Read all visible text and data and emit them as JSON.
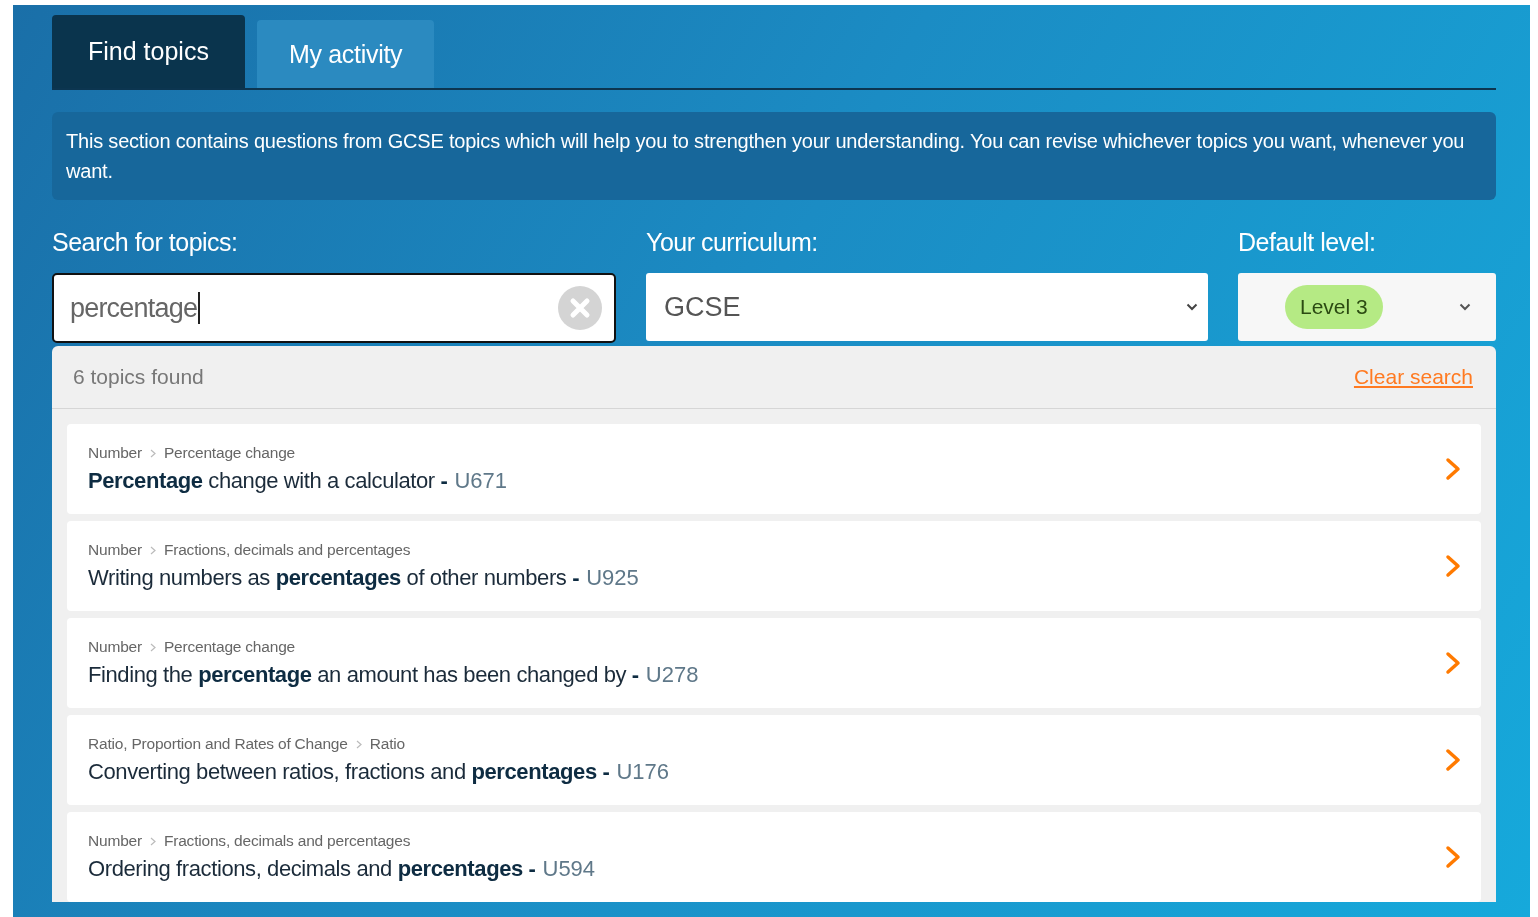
{
  "tabs": [
    {
      "label": "Find topics",
      "selected": true
    },
    {
      "label": "My activity",
      "selected": false
    }
  ],
  "intro": "This section contains questions from GCSE topics which will help you to strengthen your understanding. You can revise whichever topics you want, whenever you want.",
  "search": {
    "label": "Search for topics:",
    "value": "percentage"
  },
  "curriculum": {
    "label": "Your curriculum:",
    "value": "GCSE"
  },
  "level": {
    "label": "Default level:",
    "value": "Level 3"
  },
  "results": {
    "count": "6 topics found",
    "clear": "Clear search",
    "items": [
      {
        "breadcrumb": [
          "Number",
          "Percentage change"
        ],
        "title": "**Percentage** change with a calculator **-**",
        "code": "U671"
      },
      {
        "breadcrumb": [
          "Number",
          "Fractions, decimals and percentages"
        ],
        "title": "Writing numbers as **percentages** of other numbers **-**",
        "code": "U925"
      },
      {
        "breadcrumb": [
          "Number",
          "Percentage change"
        ],
        "title": "Finding the **percentage** an amount has been changed by **-**",
        "code": "U278"
      },
      {
        "breadcrumb": [
          "Ratio, Proportion and Rates of Change",
          "Ratio"
        ],
        "title": "Converting between ratios, fractions and **percentages** **-**",
        "code": "U176"
      },
      {
        "breadcrumb": [
          "Number",
          "Fractions, decimals and percentages"
        ],
        "title": "Ordering fractions, decimals and **percentages** **-**",
        "code": "U594"
      }
    ]
  }
}
